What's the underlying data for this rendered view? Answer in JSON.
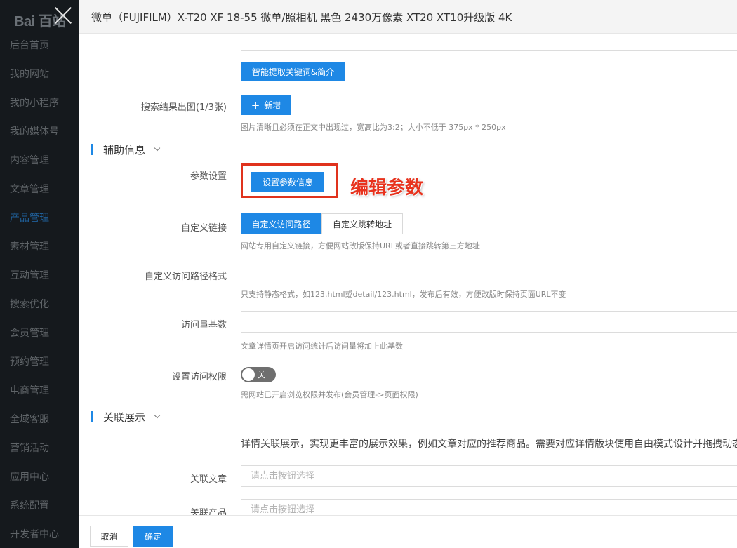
{
  "sidebar": {
    "logo": "Bai 百站",
    "items": [
      {
        "label": "后台首页"
      },
      {
        "label": "我的网站"
      },
      {
        "label": "我的小程序"
      },
      {
        "label": "我的媒体号"
      },
      {
        "label": "内容管理"
      },
      {
        "label": "文章管理"
      },
      {
        "label": "产品管理",
        "active": true
      },
      {
        "label": "素材管理"
      },
      {
        "label": "互动管理"
      },
      {
        "label": "搜索优化"
      },
      {
        "label": "会员管理"
      },
      {
        "label": "预约管理"
      },
      {
        "label": "电商管理"
      },
      {
        "label": "全域客服"
      },
      {
        "label": "营销活动"
      },
      {
        "label": "应用中心"
      },
      {
        "label": "系统配置"
      },
      {
        "label": "开发者中心"
      }
    ]
  },
  "drawer": {
    "title": "微单（FUJIFILM）X-T20 XF 18-55 微单/照相机 黑色 2430万像素 XT20 XT10升级版 4K"
  },
  "form": {
    "extract_button": "智能提取关键词&简介",
    "search_image": {
      "label": "搜索结果出图(1/3张)",
      "add_button": "新增",
      "hint": "图片清晰且必须在正文中出现过，宽高比为3:2；大小不低于 375px * 250px"
    },
    "aux_section": "辅助信息",
    "params": {
      "label": "参数设置",
      "button": "设置参数信息"
    },
    "annotation": "编辑参数",
    "custom_link": {
      "label": "自定义链接",
      "tab_path": "自定义访问路径",
      "tab_redirect": "自定义跳转地址",
      "hint": "网站专用自定义链接，方便网站改版保持URL或者直接跳转第三方地址"
    },
    "path_format": {
      "label": "自定义访问路径格式",
      "value": "",
      "hint": "只支持静态格式，如123.html或detail/123.html，发布后有效，方便改版时保持页面URL不变"
    },
    "visit_base": {
      "label": "访问量基数",
      "value": "",
      "hint": "文章详情页开启访问统计后访问量将加上此基数"
    },
    "access": {
      "label": "设置访问权限",
      "toggle_label": "关",
      "hint": "需网站已开启浏览权限并发布(会员管理->页面权限)"
    },
    "related_section": "关联展示",
    "related_desc": "详情关联展示，实现更丰富的展示效果，例如文章对应的推荐商品。需要对应详情版块使用自由模式设计并拖拽动态",
    "related_article": {
      "label": "关联文章",
      "placeholder": "请点击按钮选择"
    },
    "related_product": {
      "label": "关联产品",
      "placeholder": "请点击按钮选择"
    }
  },
  "footer": {
    "cancel": "取消",
    "confirm": "确定"
  },
  "colors": {
    "primary": "#1e88e5",
    "sidebar_bg": "#15191d",
    "annotation_red": "#e8321d"
  }
}
